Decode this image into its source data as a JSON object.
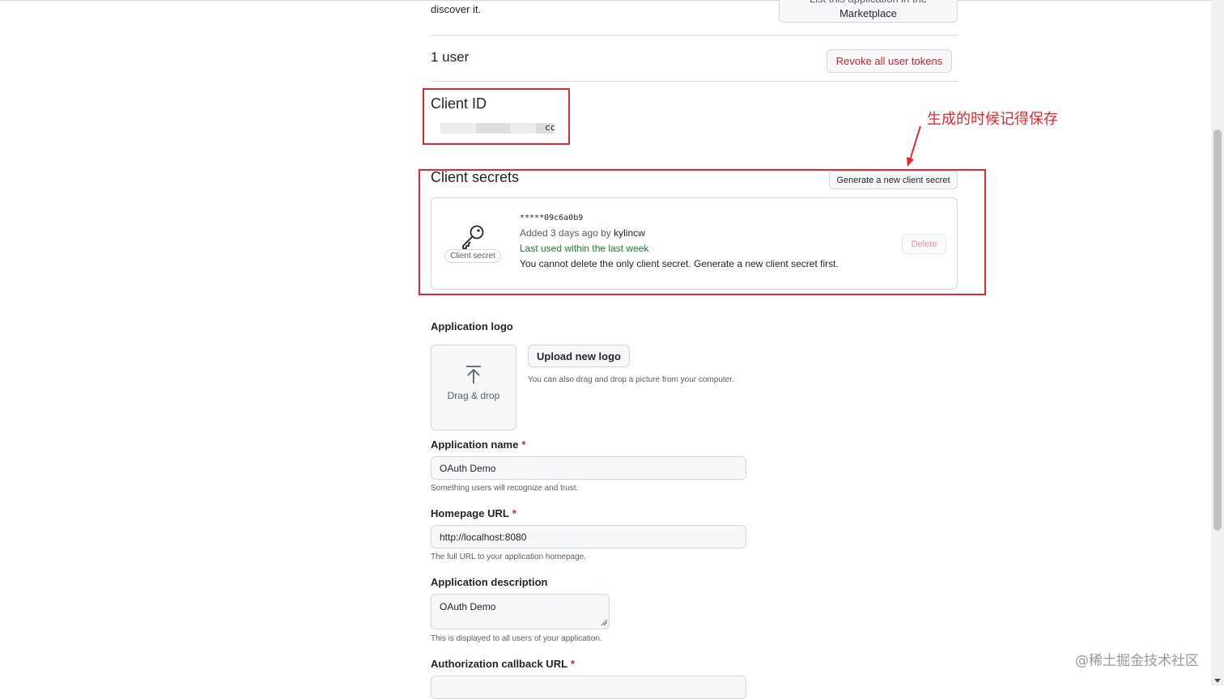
{
  "marketplace": {
    "discover_text": "discover it.",
    "button_line1": "List this application in the",
    "button_line2": "Marketplace"
  },
  "users": {
    "heading": "1 user",
    "revoke_label": "Revoke all user tokens"
  },
  "client_id": {
    "label": "Client ID",
    "value_visible_tail": "cc"
  },
  "client_secrets": {
    "label": "Client secrets",
    "generate_label": "Generate a new client secret",
    "secret": {
      "badge": "Client secret",
      "code": "*****09c6a0b9",
      "added_prefix": "Added 3 days ago by",
      "added_user": "kylincw",
      "last_used": "Last used within the last week",
      "note": "You cannot delete the only client secret. Generate a new client secret first.",
      "delete_label": "Delete"
    }
  },
  "application_logo": {
    "label": "Application logo",
    "drop_text": "Drag & drop",
    "upload_label": "Upload new logo",
    "upload_note": "You can also drag and drop a picture from your computer."
  },
  "application_name": {
    "label": "Application name",
    "required_mark": "*",
    "value": "OAuth Demo",
    "hint": "Something users will recognize and trust."
  },
  "homepage_url": {
    "label": "Homepage URL",
    "required_mark": "*",
    "value": "http://localhost:8080",
    "hint": "The full URL to your application homepage."
  },
  "application_description": {
    "label": "Application description",
    "value": "OAuth Demo",
    "hint": "This is displayed to all users of your application."
  },
  "callback_url": {
    "label": "Authorization callback URL",
    "required_mark": "*"
  },
  "annotation": {
    "text": "生成的时候记得保存",
    "color": "#e0282e"
  },
  "watermark": "@稀土掘金技术社区",
  "colors": {
    "danger": "#cf222e",
    "success": "#1a7f37",
    "border": "#d0d7de"
  }
}
